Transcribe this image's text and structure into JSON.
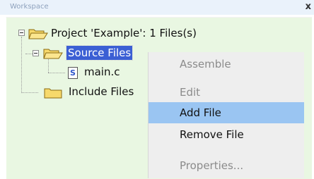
{
  "window": {
    "title": "Workspace",
    "close_label": "x"
  },
  "tree": {
    "project": "Project 'Example': 1 Files(s)",
    "source_group": "Source Files",
    "file": "main.c",
    "include_group": "Include Files"
  },
  "context_menu": {
    "items": [
      {
        "label": "Assemble",
        "enabled": false
      },
      {
        "label": "Edit",
        "enabled": false
      },
      {
        "label": "Add File",
        "enabled": true,
        "highlighted": true
      },
      {
        "label": "Remove File",
        "enabled": true
      },
      {
        "label": "Properties...",
        "enabled": false
      }
    ]
  },
  "colors": {
    "panel_bg": "#e9f7e2",
    "selection": "#3b5fd4",
    "menu_highlight": "#9ac5f2",
    "folder_fill": "#f7d96b"
  }
}
